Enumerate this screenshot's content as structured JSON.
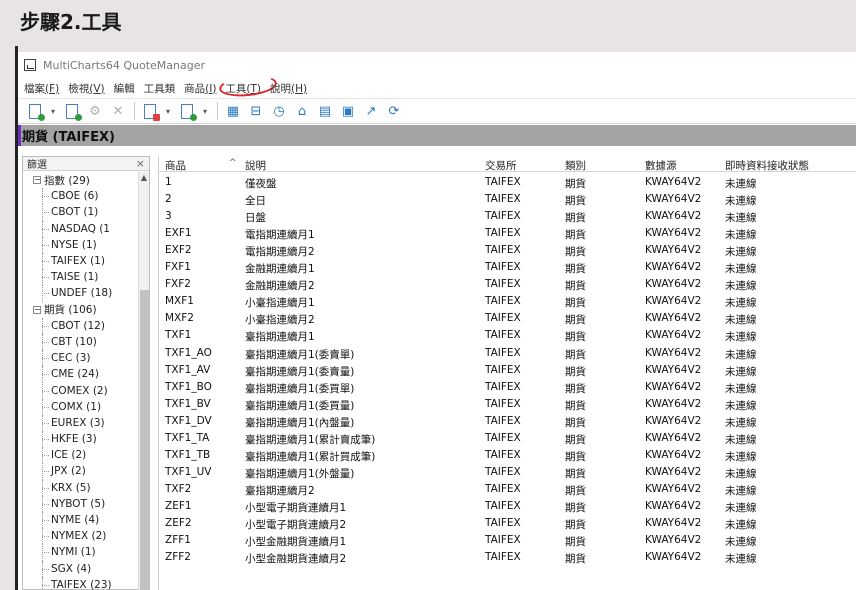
{
  "heading": "步驟2.工具",
  "window": {
    "title": "MultiCharts64 QuoteManager"
  },
  "menu": [
    {
      "label": "檔案",
      "key": "(F)"
    },
    {
      "label": "檢視",
      "key": "(V)"
    },
    {
      "label": "編輯",
      "key": ""
    },
    {
      "label": "工具類",
      "key": ""
    },
    {
      "label": "商品",
      "key": "(I)"
    },
    {
      "label": "工具",
      "key": "(T)"
    },
    {
      "label": "說明",
      "key": "(H)"
    }
  ],
  "section_title": "期貨 (TAIFEX)",
  "filter": {
    "title": "篩選",
    "close": "×",
    "tree": [
      {
        "level": 0,
        "expander": "−",
        "label": "指數 (29)"
      },
      {
        "level": 1,
        "label": "CBOE (6)"
      },
      {
        "level": 1,
        "label": "CBOT (1)"
      },
      {
        "level": 1,
        "label": "NASDAQ (1"
      },
      {
        "level": 1,
        "label": "NYSE (1)"
      },
      {
        "level": 1,
        "label": "TAIFEX (1)"
      },
      {
        "level": 1,
        "label": "TAISE (1)"
      },
      {
        "level": 1,
        "label": "UNDEF (18)"
      },
      {
        "level": 0,
        "expander": "−",
        "label": "期貨 (106)"
      },
      {
        "level": 1,
        "label": "CBOT (12)"
      },
      {
        "level": 1,
        "label": "CBT (10)"
      },
      {
        "level": 1,
        "label": "CEC (3)"
      },
      {
        "level": 1,
        "label": "CME (24)"
      },
      {
        "level": 1,
        "label": "COMEX (2)"
      },
      {
        "level": 1,
        "label": "COMX (1)"
      },
      {
        "level": 1,
        "label": "EUREX (3)"
      },
      {
        "level": 1,
        "label": "HKFE (3)"
      },
      {
        "level": 1,
        "label": "ICE (2)"
      },
      {
        "level": 1,
        "label": "JPX (2)"
      },
      {
        "level": 1,
        "label": "KRX (5)"
      },
      {
        "level": 1,
        "label": "NYBOT (5)"
      },
      {
        "level": 1,
        "label": "NYME (4)"
      },
      {
        "level": 1,
        "label": "NYMEX (2)"
      },
      {
        "level": 1,
        "label": "NYMI (1)"
      },
      {
        "level": 1,
        "label": "SGX (4)"
      },
      {
        "level": 1,
        "label": "TAIFEX (23)"
      }
    ]
  },
  "table": {
    "columns": [
      "商品",
      "說明",
      "交易所",
      "類別",
      "數據源",
      "即時資料接收狀態"
    ],
    "rows": [
      [
        "1",
        "僅夜盤",
        "TAIFEX",
        "期貨",
        "KWAY64V2",
        "未連線"
      ],
      [
        "2",
        "全日",
        "TAIFEX",
        "期貨",
        "KWAY64V2",
        "未連線"
      ],
      [
        "3",
        "日盤",
        "TAIFEX",
        "期貨",
        "KWAY64V2",
        "未連線"
      ],
      [
        "EXF1",
        "電指期連續月1",
        "TAIFEX",
        "期貨",
        "KWAY64V2",
        "未連線"
      ],
      [
        "EXF2",
        "電指期連續月2",
        "TAIFEX",
        "期貨",
        "KWAY64V2",
        "未連線"
      ],
      [
        "FXF1",
        "金融期連續月1",
        "TAIFEX",
        "期貨",
        "KWAY64V2",
        "未連線"
      ],
      [
        "FXF2",
        "金融期連續月2",
        "TAIFEX",
        "期貨",
        "KWAY64V2",
        "未連線"
      ],
      [
        "MXF1",
        "小臺指連續月1",
        "TAIFEX",
        "期貨",
        "KWAY64V2",
        "未連線"
      ],
      [
        "MXF2",
        "小臺指連續月2",
        "TAIFEX",
        "期貨",
        "KWAY64V2",
        "未連線"
      ],
      [
        "TXF1",
        "臺指期連續月1",
        "TAIFEX",
        "期貨",
        "KWAY64V2",
        "未連線"
      ],
      [
        "TXF1_AO",
        "臺指期連續月1(委賣單)",
        "TAIFEX",
        "期貨",
        "KWAY64V2",
        "未連線"
      ],
      [
        "TXF1_AV",
        "臺指期連續月1(委賣量)",
        "TAIFEX",
        "期貨",
        "KWAY64V2",
        "未連線"
      ],
      [
        "TXF1_BO",
        "臺指期連續月1(委買單)",
        "TAIFEX",
        "期貨",
        "KWAY64V2",
        "未連線"
      ],
      [
        "TXF1_BV",
        "臺指期連續月1(委買量)",
        "TAIFEX",
        "期貨",
        "KWAY64V2",
        "未連線"
      ],
      [
        "TXF1_DV",
        "臺指期連續月1(內盤量)",
        "TAIFEX",
        "期貨",
        "KWAY64V2",
        "未連線"
      ],
      [
        "TXF1_TA",
        "臺指期連續月1(累計賣成筆)",
        "TAIFEX",
        "期貨",
        "KWAY64V2",
        "未連線"
      ],
      [
        "TXF1_TB",
        "臺指期連續月1(累計買成筆)",
        "TAIFEX",
        "期貨",
        "KWAY64V2",
        "未連線"
      ],
      [
        "TXF1_UV",
        "臺指期連續月1(外盤量)",
        "TAIFEX",
        "期貨",
        "KWAY64V2",
        "未連線"
      ],
      [
        "TXF2",
        "臺指期連續月2",
        "TAIFEX",
        "期貨",
        "KWAY64V2",
        "未連線"
      ],
      [
        "ZEF1",
        "小型電子期貨連續月1",
        "TAIFEX",
        "期貨",
        "KWAY64V2",
        "未連線"
      ],
      [
        "ZEF2",
        "小型電子期貨連續月2",
        "TAIFEX",
        "期貨",
        "KWAY64V2",
        "未連線"
      ],
      [
        "ZFF1",
        "小型金融期貨連續月1",
        "TAIFEX",
        "期貨",
        "KWAY64V2",
        "未連線"
      ],
      [
        "ZFF2",
        "小型金融期貨連續月2",
        "TAIFEX",
        "期貨",
        "KWAY64V2",
        "未連線"
      ]
    ]
  },
  "colors": {
    "highlight": "#d9262c",
    "section_bg": "#a3a3a3",
    "accent_bar": "#6b2fbf"
  }
}
